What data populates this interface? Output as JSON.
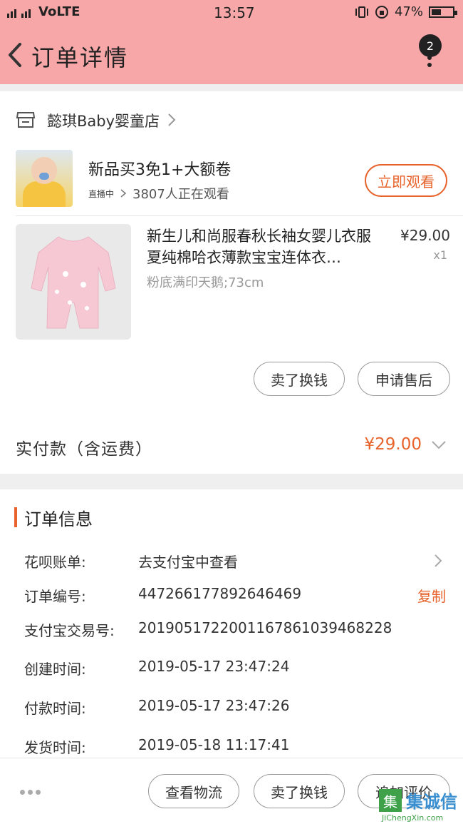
{
  "status_bar": {
    "network": "3G 4G",
    "carrier": "VoLTE",
    "time": "13:57",
    "battery": "47%",
    "battery_level": 0.47
  },
  "header": {
    "title": "订单详情",
    "badge_count": "2"
  },
  "shop": {
    "name": "懿琪Baby婴童店"
  },
  "live": {
    "title": "新品买3免1+大额卷",
    "tag": "直播中",
    "viewers": "3807人正在观看",
    "watch_label": "立即观看"
  },
  "product": {
    "title": "新生儿和尚服春秋长袖女婴儿衣服夏纯棉哈衣薄款宝宝连体衣…",
    "spec": "粉底满印天鹅;73cm",
    "price": "¥29.00",
    "qty": "x1"
  },
  "product_actions": {
    "sell": "卖了换钱",
    "after_sale": "申请售后"
  },
  "payment": {
    "label": "实付款（含运费）",
    "amount": "¥29.00"
  },
  "order_info": {
    "title": "订单信息",
    "rows": [
      {
        "label": "花呗账单:",
        "value": "去支付宝中查看",
        "action": ""
      },
      {
        "label": "订单编号:",
        "value": "447266177892646469",
        "action": "复制"
      },
      {
        "label": "支付宝交易号:",
        "value": "2019051722001167861039468228",
        "action": ""
      },
      {
        "label": "创建时间:",
        "value": "2019-05-17 23:47:24",
        "action": ""
      },
      {
        "label": "付款时间:",
        "value": "2019-05-17 23:47:26",
        "action": ""
      },
      {
        "label": "发货时间:",
        "value": "2019-05-18 11:17:41",
        "action": ""
      }
    ]
  },
  "bottom_actions": {
    "logistics": "查看物流",
    "sell": "卖了换钱",
    "review": "追加评价"
  },
  "watermark": {
    "text": "集诚信",
    "url": "JiChengXin.com"
  },
  "colors": {
    "header_bg": "#f7a7a8",
    "accent": "#e7632b"
  }
}
